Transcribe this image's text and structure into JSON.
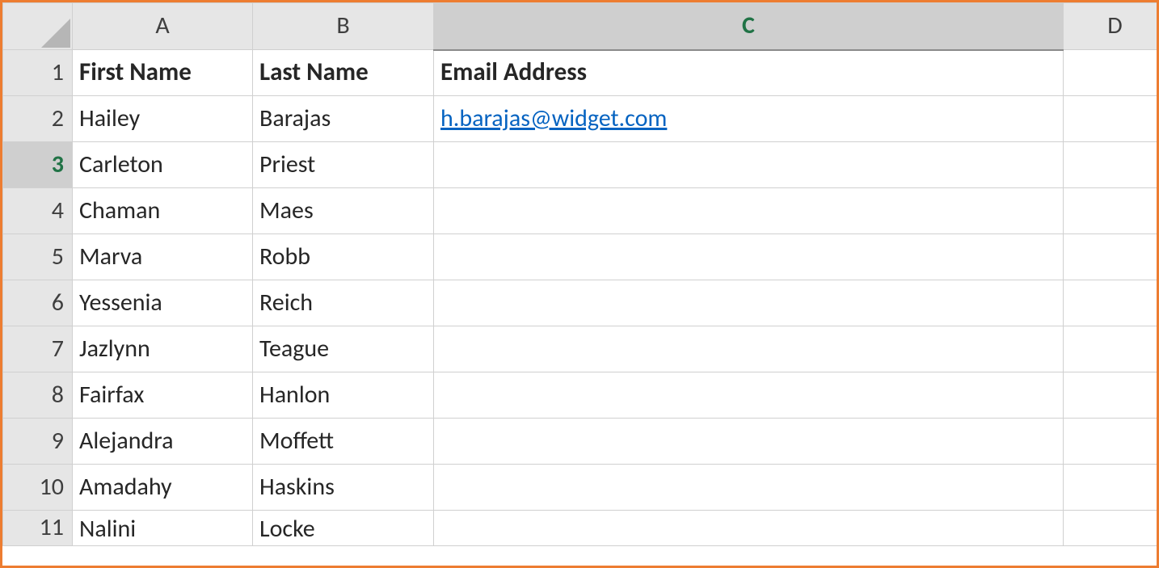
{
  "columns": {
    "a": "A",
    "b": "B",
    "c": "C",
    "d": "D"
  },
  "selected_column": "C",
  "selected_row": "3",
  "headers": {
    "first_name": "First Name",
    "last_name": "Last Name",
    "email": "Email Address"
  },
  "rows": [
    {
      "n": "1",
      "first": "First Name",
      "last": "Last Name",
      "email": "Email Address",
      "is_header": true
    },
    {
      "n": "2",
      "first": "Hailey",
      "last": "Barajas",
      "email": "h.barajas@widget.com",
      "is_link": true
    },
    {
      "n": "3",
      "first": "Carleton",
      "last": "Priest",
      "email": ""
    },
    {
      "n": "4",
      "first": "Chaman",
      "last": "Maes",
      "email": ""
    },
    {
      "n": "5",
      "first": "Marva",
      "last": "Robb",
      "email": ""
    },
    {
      "n": "6",
      "first": "Yessenia",
      "last": "Reich",
      "email": ""
    },
    {
      "n": "7",
      "first": "Jazlynn",
      "last": "Teague",
      "email": ""
    },
    {
      "n": "8",
      "first": "Fairfax",
      "last": "Hanlon",
      "email": ""
    },
    {
      "n": "9",
      "first": "Alejandra",
      "last": "Moffett",
      "email": ""
    },
    {
      "n": "10",
      "first": "Amadahy",
      "last": "Haskins",
      "email": ""
    },
    {
      "n": "11",
      "first": "Nalini",
      "last": "Locke",
      "email": ""
    }
  ]
}
